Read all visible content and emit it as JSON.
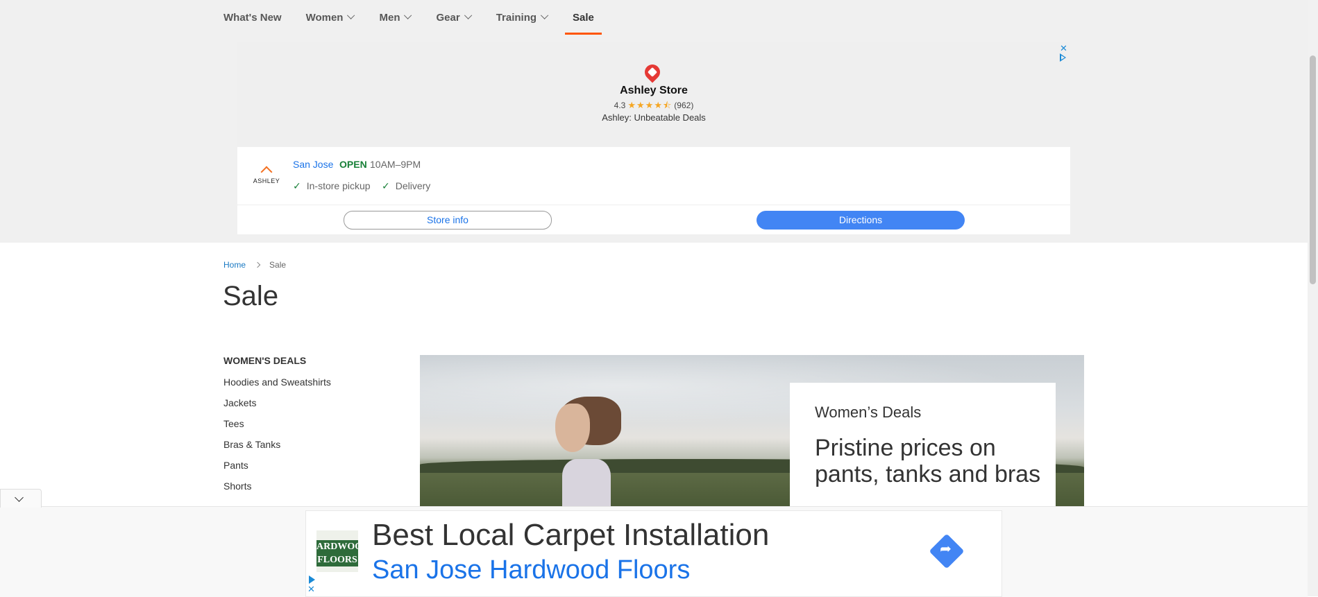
{
  "nav": {
    "items": [
      {
        "label": "What's New",
        "dropdown": false
      },
      {
        "label": "Women",
        "dropdown": true
      },
      {
        "label": "Men",
        "dropdown": true
      },
      {
        "label": "Gear",
        "dropdown": true
      },
      {
        "label": "Training",
        "dropdown": true
      },
      {
        "label": "Sale",
        "dropdown": false,
        "active": true
      }
    ],
    "active_color": "#ff5501"
  },
  "store_ad": {
    "close_icon": "close-icon",
    "adchoices_icon": "adchoices-icon",
    "pin_icon": "map-pin-icon",
    "store_name": "Ashley Store",
    "rating": "4.3",
    "stars": "★★★★⯪",
    "rating_value": 4.3,
    "review_count": "(962)",
    "tagline": "Ashley: Unbeatable Deals",
    "logo_text": "ASHLEY",
    "city": "San Jose",
    "status": "OPEN",
    "hours": "10AM–9PM",
    "features": [
      "In-store pickup",
      "Delivery"
    ],
    "store_info_label": "Store info",
    "directions_label": "Directions",
    "accent": "#1a73e8",
    "open_color": "#188038",
    "directions_color": "#4285f4"
  },
  "breadcrumb": {
    "home": "Home",
    "current": "Sale"
  },
  "page": {
    "title": "Sale"
  },
  "sidebar": {
    "heading": "WOMEN'S DEALS",
    "items": [
      "Hoodies and Sweatshirts",
      "Jackets",
      "Tees",
      "Bras & Tanks",
      "Pants",
      "Shorts"
    ]
  },
  "hero": {
    "kicker": "Women’s Deals",
    "title": "Pristine prices on pants, tanks and bras"
  },
  "bottom_ad": {
    "logo_text": "ARDWOO FLOORS",
    "title": "Best Local Carpet Installation",
    "subtitle": "San Jose Hardwood Floors",
    "directions_icon": "directions-icon",
    "subtitle_color": "#1a73e8"
  }
}
